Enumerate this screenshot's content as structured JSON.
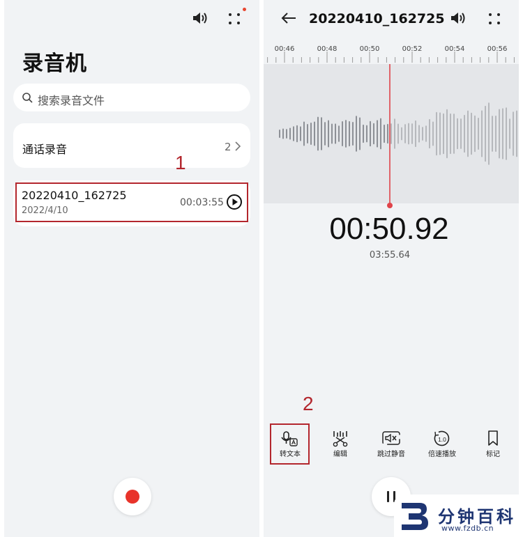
{
  "left_screen": {
    "title": "录音机",
    "speaker_icon": "speaker-icon",
    "menu_icon": "four-dots-menu-icon",
    "search": {
      "placeholder": "搜索录音文件",
      "icon": "search-icon"
    },
    "call_recordings": {
      "label": "通话录音",
      "count": "2"
    },
    "annotation": "1",
    "recordings": [
      {
        "name": "20220410_162725",
        "date": "2022/4/10",
        "duration": "00:03:55"
      }
    ]
  },
  "right_screen": {
    "file_title": "20220410_162725",
    "timeline_ticks": [
      "00:46",
      "00:48",
      "00:50",
      "00:52",
      "00:54",
      "00:56"
    ],
    "current_time": "00:50.92",
    "total_time": "03:55.64",
    "annotation": "2",
    "toolbar": [
      {
        "label": "转文本",
        "icon": "voice-to-text-icon"
      },
      {
        "label": "编辑",
        "icon": "scissors-edit-icon"
      },
      {
        "label": "跳过静音",
        "icon": "skip-silence-icon"
      },
      {
        "label": "倍速播放",
        "icon": "playback-speed-icon",
        "badge": "1.0"
      },
      {
        "label": "标记",
        "icon": "bookmark-icon"
      }
    ]
  },
  "watermark": {
    "name": "分钟百科",
    "url": "www.fzdb.cn"
  },
  "colors": {
    "accent_red": "#e8332a",
    "annotation_red": "#b3262d",
    "background": "#f1f3f5",
    "brand_blue": "#1e3572"
  }
}
